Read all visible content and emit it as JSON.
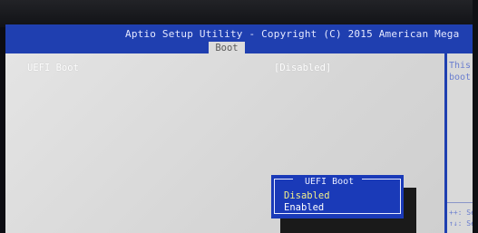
{
  "header": {
    "title": "Aptio Setup Utility - Copyright (C) 2015 American Mega",
    "active_tab": "Boot"
  },
  "settings": [
    {
      "label": "UEFI Boot",
      "value": "[Disabled]"
    }
  ],
  "help": {
    "text": "This\nboot",
    "keys": "++: Se\n↑↓: Se"
  },
  "popup": {
    "title": "UEFI Boot",
    "options": [
      "Disabled",
      "Enabled"
    ],
    "selected": "Disabled"
  },
  "colors": {
    "title_bar": "#1f3fb0",
    "popup_background": "#1a3ab8",
    "panel_background": "#dcdcdc",
    "highlight_text": "#f2ef8a",
    "help_text": "#6a7ecf"
  }
}
